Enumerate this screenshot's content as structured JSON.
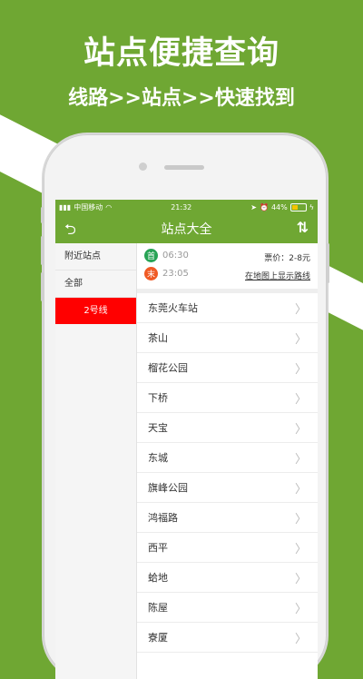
{
  "promo": {
    "title": "站点便捷查询",
    "subtitle": "线路>>站点>>快速找到"
  },
  "statusbar": {
    "carrier": "中国移动",
    "time": "21:32",
    "battery": "44%"
  },
  "appbar": {
    "title": "站点大全"
  },
  "sidebar": {
    "items": [
      {
        "label": "附近站点"
      },
      {
        "label": "全部"
      },
      {
        "label": "2号线"
      }
    ]
  },
  "line_info": {
    "first_badge": "首",
    "first_time": "06:30",
    "last_badge": "末",
    "last_time": "23:05",
    "fare": "票价：2-8元",
    "map_link": "在地图上显示路线"
  },
  "stops": [
    {
      "name": "东莞火车站"
    },
    {
      "name": "茶山"
    },
    {
      "name": "榴花公园"
    },
    {
      "name": "下桥"
    },
    {
      "name": "天宝"
    },
    {
      "name": "东城"
    },
    {
      "name": "旗峰公园"
    },
    {
      "name": "鸿福路"
    },
    {
      "name": "西平"
    },
    {
      "name": "蛤地"
    },
    {
      "name": "陈屋"
    },
    {
      "name": "寮厦"
    }
  ],
  "colors": {
    "brand_green": "#6fa733",
    "active_red": "#ff0000",
    "first_badge": "#27a355",
    "last_badge": "#f05a24"
  }
}
